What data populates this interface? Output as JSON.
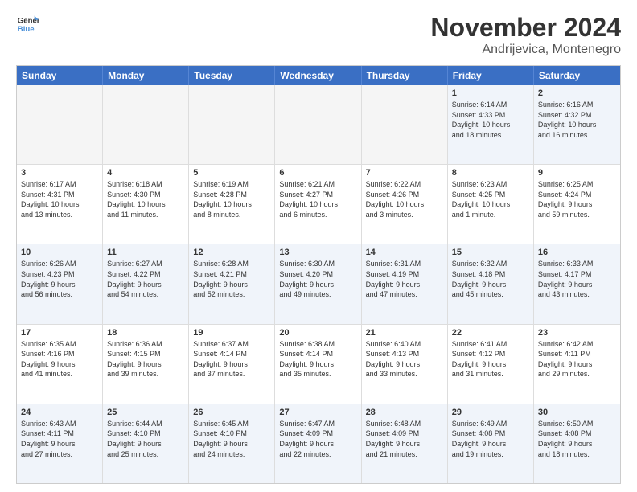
{
  "header": {
    "logo": {
      "line1": "General",
      "line2": "Blue"
    },
    "title": "November 2024",
    "location": "Andrijevica, Montenegro"
  },
  "weekdays": [
    "Sunday",
    "Monday",
    "Tuesday",
    "Wednesday",
    "Thursday",
    "Friday",
    "Saturday"
  ],
  "rows": [
    [
      {
        "day": "",
        "info": "",
        "empty": true
      },
      {
        "day": "",
        "info": "",
        "empty": true
      },
      {
        "day": "",
        "info": "",
        "empty": true
      },
      {
        "day": "",
        "info": "",
        "empty": true
      },
      {
        "day": "",
        "info": "",
        "empty": true
      },
      {
        "day": "1",
        "info": "Sunrise: 6:14 AM\nSunset: 4:33 PM\nDaylight: 10 hours\nand 18 minutes."
      },
      {
        "day": "2",
        "info": "Sunrise: 6:16 AM\nSunset: 4:32 PM\nDaylight: 10 hours\nand 16 minutes."
      }
    ],
    [
      {
        "day": "3",
        "info": "Sunrise: 6:17 AM\nSunset: 4:31 PM\nDaylight: 10 hours\nand 13 minutes."
      },
      {
        "day": "4",
        "info": "Sunrise: 6:18 AM\nSunset: 4:30 PM\nDaylight: 10 hours\nand 11 minutes."
      },
      {
        "day": "5",
        "info": "Sunrise: 6:19 AM\nSunset: 4:28 PM\nDaylight: 10 hours\nand 8 minutes."
      },
      {
        "day": "6",
        "info": "Sunrise: 6:21 AM\nSunset: 4:27 PM\nDaylight: 10 hours\nand 6 minutes."
      },
      {
        "day": "7",
        "info": "Sunrise: 6:22 AM\nSunset: 4:26 PM\nDaylight: 10 hours\nand 3 minutes."
      },
      {
        "day": "8",
        "info": "Sunrise: 6:23 AM\nSunset: 4:25 PM\nDaylight: 10 hours\nand 1 minute."
      },
      {
        "day": "9",
        "info": "Sunrise: 6:25 AM\nSunset: 4:24 PM\nDaylight: 9 hours\nand 59 minutes."
      }
    ],
    [
      {
        "day": "10",
        "info": "Sunrise: 6:26 AM\nSunset: 4:23 PM\nDaylight: 9 hours\nand 56 minutes."
      },
      {
        "day": "11",
        "info": "Sunrise: 6:27 AM\nSunset: 4:22 PM\nDaylight: 9 hours\nand 54 minutes."
      },
      {
        "day": "12",
        "info": "Sunrise: 6:28 AM\nSunset: 4:21 PM\nDaylight: 9 hours\nand 52 minutes."
      },
      {
        "day": "13",
        "info": "Sunrise: 6:30 AM\nSunset: 4:20 PM\nDaylight: 9 hours\nand 49 minutes."
      },
      {
        "day": "14",
        "info": "Sunrise: 6:31 AM\nSunset: 4:19 PM\nDaylight: 9 hours\nand 47 minutes."
      },
      {
        "day": "15",
        "info": "Sunrise: 6:32 AM\nSunset: 4:18 PM\nDaylight: 9 hours\nand 45 minutes."
      },
      {
        "day": "16",
        "info": "Sunrise: 6:33 AM\nSunset: 4:17 PM\nDaylight: 9 hours\nand 43 minutes."
      }
    ],
    [
      {
        "day": "17",
        "info": "Sunrise: 6:35 AM\nSunset: 4:16 PM\nDaylight: 9 hours\nand 41 minutes."
      },
      {
        "day": "18",
        "info": "Sunrise: 6:36 AM\nSunset: 4:15 PM\nDaylight: 9 hours\nand 39 minutes."
      },
      {
        "day": "19",
        "info": "Sunrise: 6:37 AM\nSunset: 4:14 PM\nDaylight: 9 hours\nand 37 minutes."
      },
      {
        "day": "20",
        "info": "Sunrise: 6:38 AM\nSunset: 4:14 PM\nDaylight: 9 hours\nand 35 minutes."
      },
      {
        "day": "21",
        "info": "Sunrise: 6:40 AM\nSunset: 4:13 PM\nDaylight: 9 hours\nand 33 minutes."
      },
      {
        "day": "22",
        "info": "Sunrise: 6:41 AM\nSunset: 4:12 PM\nDaylight: 9 hours\nand 31 minutes."
      },
      {
        "day": "23",
        "info": "Sunrise: 6:42 AM\nSunset: 4:11 PM\nDaylight: 9 hours\nand 29 minutes."
      }
    ],
    [
      {
        "day": "24",
        "info": "Sunrise: 6:43 AM\nSunset: 4:11 PM\nDaylight: 9 hours\nand 27 minutes."
      },
      {
        "day": "25",
        "info": "Sunrise: 6:44 AM\nSunset: 4:10 PM\nDaylight: 9 hours\nand 25 minutes."
      },
      {
        "day": "26",
        "info": "Sunrise: 6:45 AM\nSunset: 4:10 PM\nDaylight: 9 hours\nand 24 minutes."
      },
      {
        "day": "27",
        "info": "Sunrise: 6:47 AM\nSunset: 4:09 PM\nDaylight: 9 hours\nand 22 minutes."
      },
      {
        "day": "28",
        "info": "Sunrise: 6:48 AM\nSunset: 4:09 PM\nDaylight: 9 hours\nand 21 minutes."
      },
      {
        "day": "29",
        "info": "Sunrise: 6:49 AM\nSunset: 4:08 PM\nDaylight: 9 hours\nand 19 minutes."
      },
      {
        "day": "30",
        "info": "Sunrise: 6:50 AM\nSunset: 4:08 PM\nDaylight: 9 hours\nand 18 minutes."
      }
    ]
  ]
}
